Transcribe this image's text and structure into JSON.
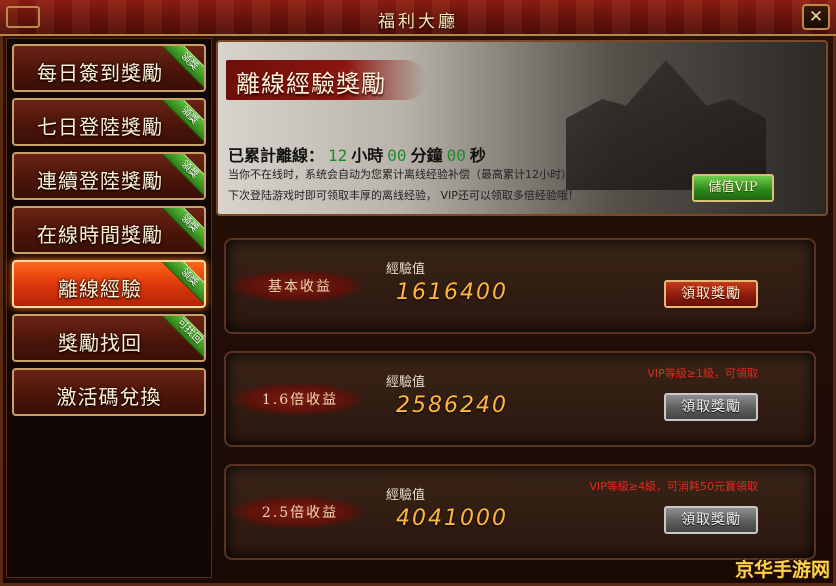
{
  "window": {
    "title": "福利大廳",
    "close_symbol": "✕"
  },
  "sidebar": {
    "items": [
      {
        "label": "每日簽到獎勵",
        "ribbon": "領獎",
        "active": false
      },
      {
        "label": "七日登陸獎勵",
        "ribbon": "領獎",
        "active": false
      },
      {
        "label": "連續登陸獎勵",
        "ribbon": "領獎",
        "active": false
      },
      {
        "label": "在線時間獎勵",
        "ribbon": "領獎",
        "active": false
      },
      {
        "label": "離線經驗",
        "ribbon": "領獎",
        "active": true
      },
      {
        "label": "獎勵找回",
        "ribbon": "可找回",
        "active": false
      },
      {
        "label": "激活碼兌換",
        "ribbon": "",
        "active": false
      }
    ]
  },
  "info": {
    "heading": "離線經驗獎勵",
    "accum_prefix": "已累計離線：",
    "hours": "12",
    "hours_unit": "小時",
    "minutes": "00",
    "minutes_unit": "分鐘",
    "seconds": "00",
    "seconds_unit": "秒",
    "desc1": "当你不在线时，系统会自动为您累计离线经验补偿（最高累计12小时）",
    "desc2": "下次登陆游戏时即可领取丰厚的离线经验， VIP还可以领取多倍经验哦！",
    "vip_button": "儲值VIP"
  },
  "rewards": [
    {
      "tag": "基本收益",
      "exp_label": "經驗值",
      "exp_value": "1616400",
      "note": "",
      "button": "領取獎勵",
      "enabled": true
    },
    {
      "tag": "1.6倍收益",
      "exp_label": "經驗值",
      "exp_value": "2586240",
      "note": "VIP等級≥1級，可領取",
      "button": "領取獎勵",
      "enabled": false
    },
    {
      "tag": "2.5倍收益",
      "exp_label": "經驗值",
      "exp_value": "4041000",
      "note": "VIP等級≥4級，可消耗50元寶領取",
      "button": "領取獎勵",
      "enabled": false
    }
  ],
  "watermark": "京华手游网",
  "colors": {
    "accent_green": "#1c8b2c",
    "exp_value": "#ffb63a",
    "note_red": "#e12b1e",
    "active_tab": "#e23b0c"
  }
}
